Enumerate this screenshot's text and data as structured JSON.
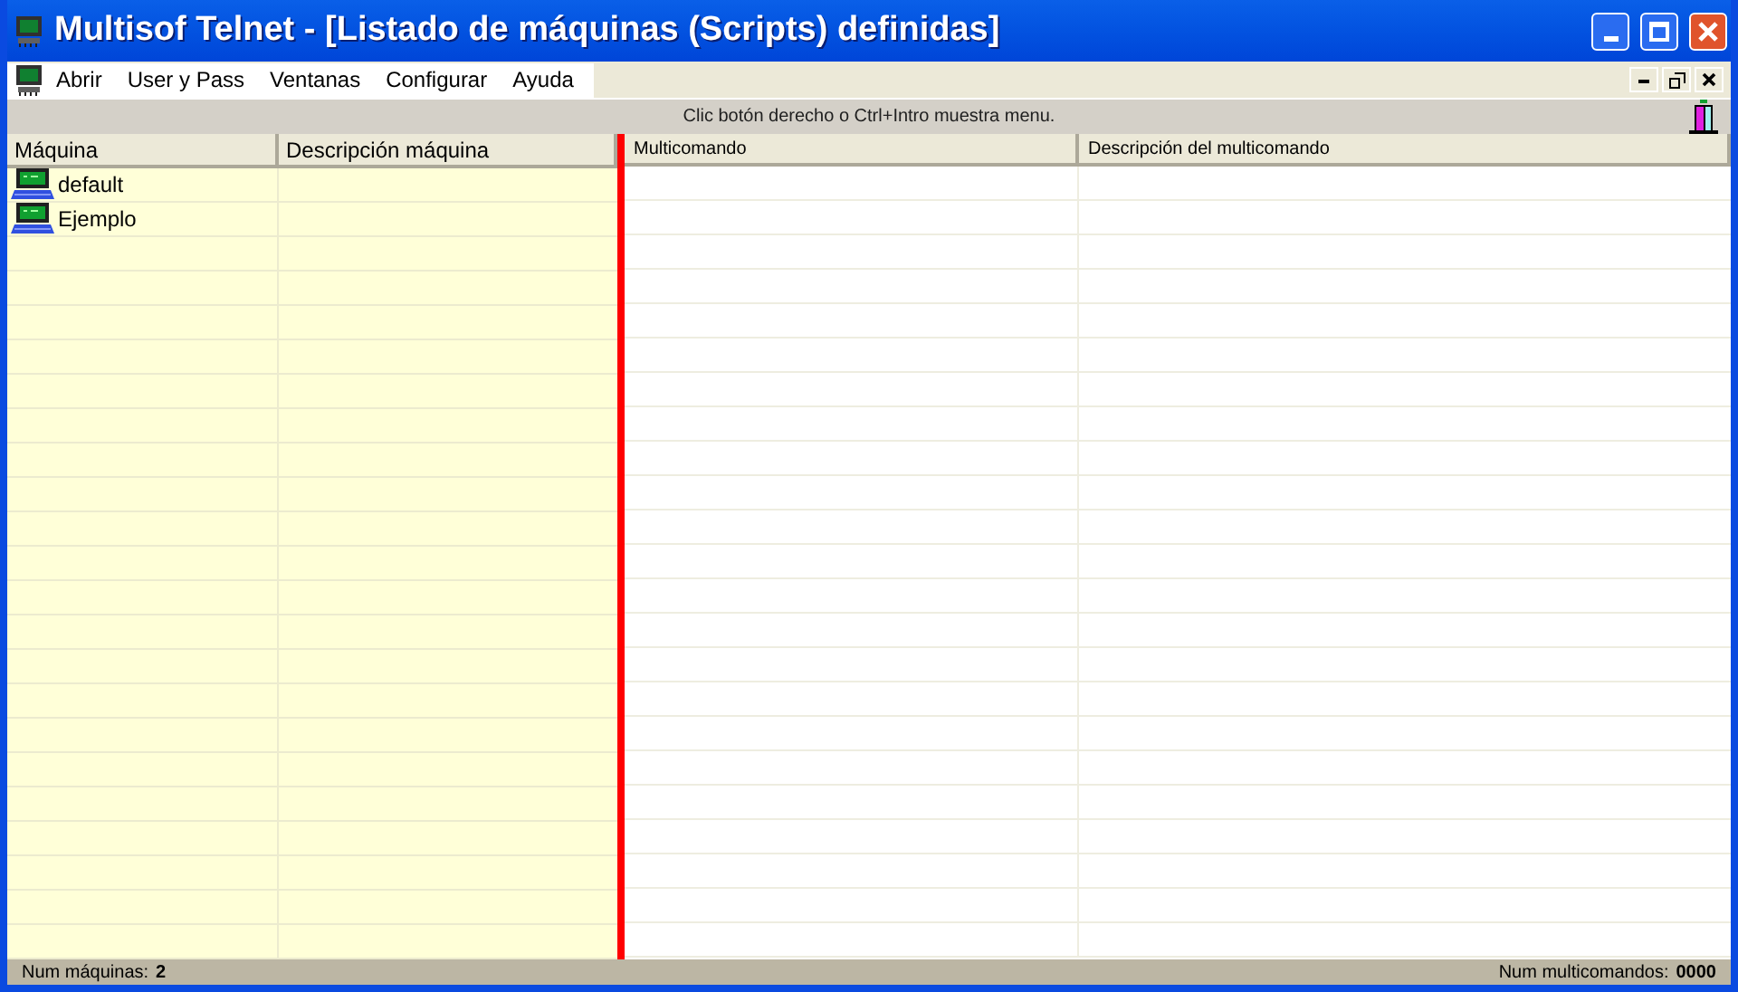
{
  "window": {
    "title": "Multisof Telnet - [Listado de máquinas (Scripts) definidas]"
  },
  "menu": [
    "Abrir",
    "User y Pass",
    "Ventanas",
    "Configurar",
    "Ayuda"
  ],
  "hint": "Clic botón derecho o Ctrl+Intro muestra menu.",
  "machines": {
    "columns": [
      "Máquina",
      "Descripción máquina"
    ],
    "rows": [
      {
        "name": "default"
      },
      {
        "name": "Ejemplo"
      }
    ]
  },
  "commands": {
    "columns": [
      "Multicomando",
      "Descripción del multicomando"
    ]
  },
  "status_bar": {
    "machines_label": "Num máquinas:",
    "machines_count": "2",
    "commands_label": "Num multicomandos:",
    "commands_count": "0000"
  }
}
